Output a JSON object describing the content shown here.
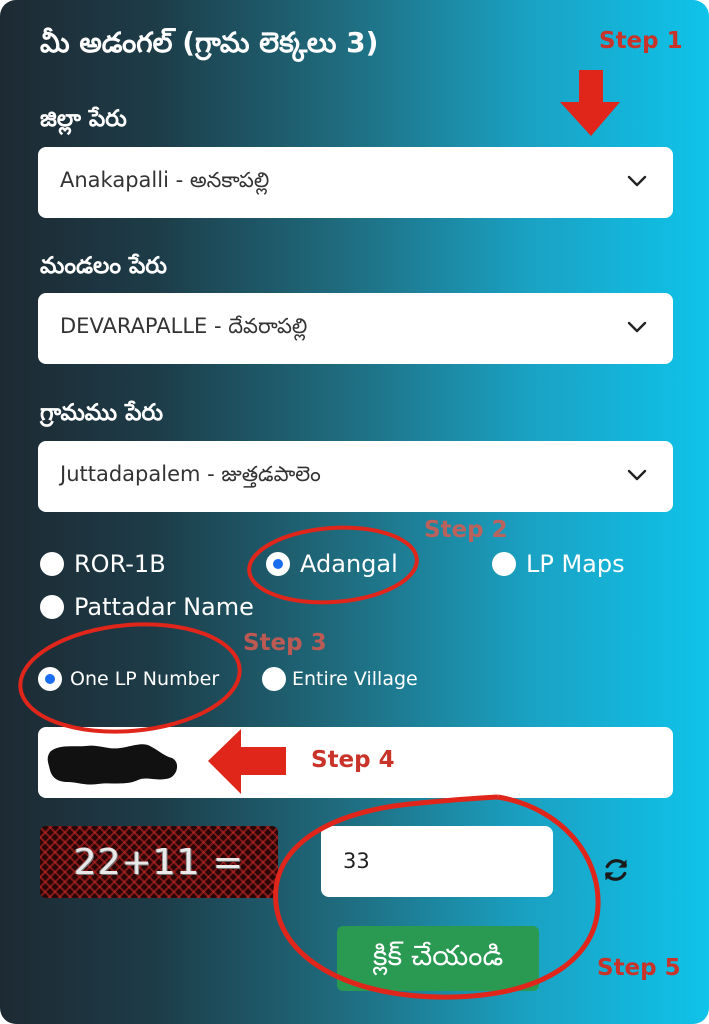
{
  "title": "మీ అడంగల్ (గ్రామ లెక్కలు 3)",
  "district": {
    "label": "జిల్లా పేరు",
    "value": "Anakapalli - అనకాపల్లి"
  },
  "mandal": {
    "label": "మండలం పేరు",
    "value": "DEVARAPALLE - దేవరాపల్లి"
  },
  "village": {
    "label": "గ్రామము పేరు",
    "value": "Juttadapalem - జుత్తడపాలెం"
  },
  "record_types": [
    {
      "label": "ROR-1B",
      "selected": false
    },
    {
      "label": "Adangal",
      "selected": true
    },
    {
      "label": "LP Maps",
      "selected": false
    },
    {
      "label": "Pattadar Name",
      "selected": false
    }
  ],
  "search_scope": [
    {
      "label": "One LP Number",
      "selected": true
    },
    {
      "label": "Entire Village",
      "selected": false
    }
  ],
  "captcha": {
    "text": "22+11 =",
    "answer": "33"
  },
  "submit_label": "క్లిక్ చేయండి",
  "annotations": {
    "step1": "Step 1",
    "step2": "Step 2",
    "step3": "Step 3",
    "step4": "Step 4",
    "step5": "Step 5"
  },
  "colors": {
    "annotation_red": "#e0261b",
    "submit_green": "#2a9a52",
    "radio_blue": "#1a6cf0"
  }
}
